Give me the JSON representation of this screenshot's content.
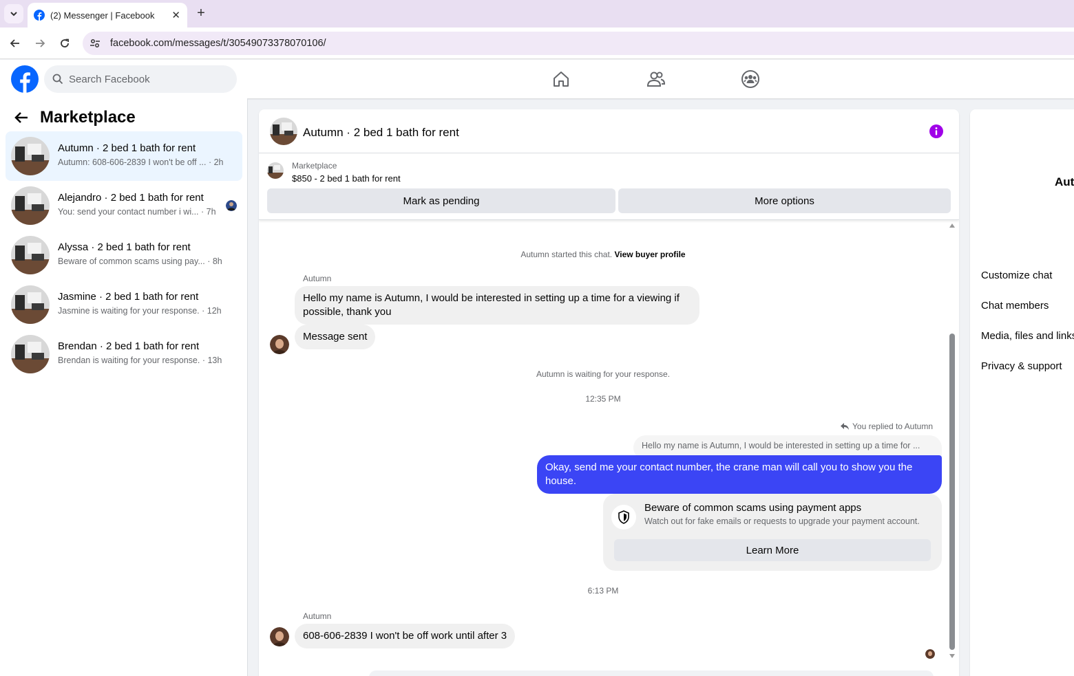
{
  "browser": {
    "tab_title": "(2) Messenger | Facebook",
    "tab_close": "✕",
    "new_tab": "+",
    "url": "facebook.com/messages/t/30549073378070106/"
  },
  "header": {
    "search_placeholder": "Search Facebook",
    "nav_icons": [
      "home-icon",
      "friends-icon",
      "groups-icon"
    ]
  },
  "sidebar": {
    "title": "Marketplace",
    "conversations": [
      {
        "name": "Autumn · 2 bed 1 bath for rent",
        "preview": "Autumn: 608-606-2839 I won't be off ... · 2h",
        "active": true
      },
      {
        "name": "Alejandro · 2 bed 1 bath for rent",
        "preview": "You: send your contact number i wi... · 7h",
        "active": false
      },
      {
        "name": "Alyssa · 2 bed 1 bath for rent",
        "preview": "Beware of common scams using pay... · 8h",
        "active": false
      },
      {
        "name": "Jasmine · 2 bed 1 bath for rent",
        "preview": "Jasmine is waiting for your response. · 12h",
        "active": false
      },
      {
        "name": "Brendan · 2 bed 1 bath for rent",
        "preview": "Brendan is waiting for your response. · 13h",
        "active": false
      }
    ]
  },
  "chat": {
    "title": "Autumn · 2 bed 1 bath for rent",
    "listing_label": "Marketplace",
    "listing_price": "$850 - 2 bed 1 bath for rent",
    "mark_pending": "Mark as pending",
    "more_options": "More options",
    "started_text": "Autumn started this chat.",
    "view_profile": "View buyer profile",
    "sender_1": "Autumn",
    "msg_1": "Hello my name is Autumn, I would be interested in setting up a time for a viewing if possible, thank you",
    "msg_2": "Message sent",
    "waiting": "Autumn is waiting for your response.",
    "time_1": "12:35 PM",
    "replied_note": "You replied to Autumn",
    "reply_quote": "Hello my name is Autumn, I would be interested in setting up a time for ...",
    "msg_out": "Okay, send me your contact number, the crane man will call you to show you the house.",
    "scam_title": "Beware of common scams using payment apps",
    "scam_text": "Watch out for fake emails or requests to upgrade your payment account.",
    "learn_more": "Learn More",
    "time_2": "6:13 PM",
    "sender_2": "Autumn",
    "msg_3": "608-606-2839 I won't be off work until after 3"
  },
  "info_panel": {
    "name": "Aut",
    "items": [
      "Customize chat",
      "Chat members",
      "Media, files and links",
      "Privacy & support"
    ]
  },
  "colors": {
    "brand": "#0866ff",
    "outgoing_bubble": "#3b45f5",
    "info_icon": "#a000e8"
  }
}
